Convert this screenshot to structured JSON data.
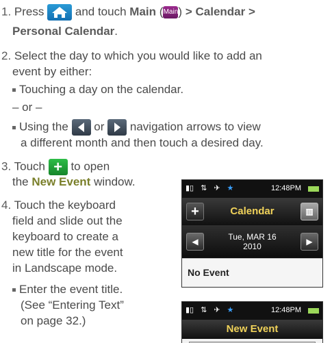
{
  "step1": {
    "num": "1.",
    "pre": "Press",
    "mid": "and touch",
    "main_label": "Main",
    "main_icon_text": "Main",
    "paren_open": "(",
    "paren_close": ")",
    "sep1": ">",
    "calendar_label": "Calendar",
    "sep2": ">",
    "personal_label": "Personal Calendar",
    "end": "."
  },
  "step2": {
    "num": "2.",
    "line1": "Select the day to which you would like to add an",
    "line2": "event by either:",
    "bullet1": "Touching a day on the calendar.",
    "or": "– or –",
    "bullet2_pre": "Using the",
    "bullet2_or": "or",
    "bullet2_post": "navigation arrows to view",
    "bullet2_line2": "a different month and then touch a desired day."
  },
  "step3": {
    "num": "3.",
    "pre": "Touch",
    "post": "to open",
    "line2_pre": "the",
    "new_event": "New Event",
    "line2_post": "window."
  },
  "step4": {
    "num": "4.",
    "lines": [
      "Touch the keyboard",
      "field and slide out the",
      "keyboard to create a",
      "new title for the event",
      "in Landscape mode."
    ],
    "bullet_lines": [
      "Enter the event title.",
      "(See “Entering Text”",
      "on page 32.)"
    ]
  },
  "phone1": {
    "time": "12:48PM",
    "title": "Calendar",
    "date_line1": "Tue, MAR 16",
    "date_line2": "2010",
    "no_event": "No Event"
  },
  "phone2": {
    "time": "12:48PM",
    "title": "New Event"
  },
  "colors": {
    "accent": "#7a7f2a",
    "title_yellow": "#f0d25a"
  }
}
